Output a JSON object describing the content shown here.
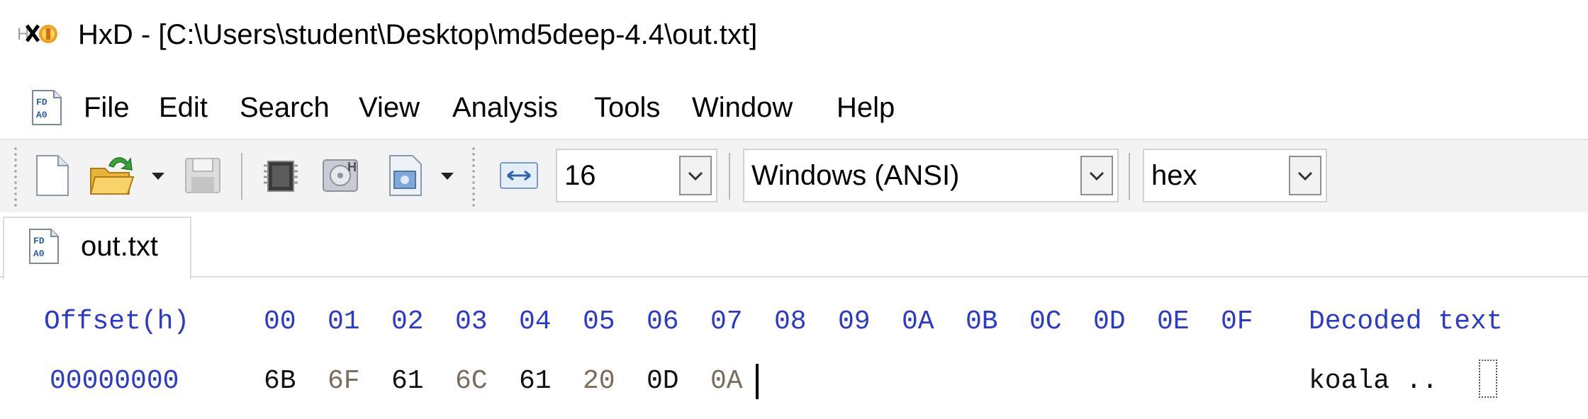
{
  "window": {
    "title": "HxD - [C:\\Users\\student\\Desktop\\md5deep-4.4\\out.txt]"
  },
  "menu": [
    "File",
    "Edit",
    "Search",
    "View",
    "Analysis",
    "Tools",
    "Window",
    "Help"
  ],
  "toolbar": {
    "bytes_per_row": "16",
    "charset": "Windows (ANSI)",
    "offset_base": "hex"
  },
  "tabs": [
    {
      "label": "out.txt",
      "active": true
    }
  ],
  "hex_view": {
    "offset_header": "Offset(h)",
    "column_headers": [
      "00",
      "01",
      "02",
      "03",
      "04",
      "05",
      "06",
      "07",
      "08",
      "09",
      "0A",
      "0B",
      "0C",
      "0D",
      "0E",
      "0F"
    ],
    "decoded_header": "Decoded text",
    "rows": [
      {
        "offset": "00000000",
        "bytes": [
          "6B",
          "6F",
          "61",
          "6C",
          "61",
          "20",
          "0D",
          "0A"
        ],
        "decoded": "koala .."
      }
    ]
  },
  "colors": {
    "header_blue": "#2a3acb",
    "byte_dark": "#111111",
    "byte_light": "#7a6c5c",
    "toolbar_bg": "#f3f3f3"
  },
  "icons": [
    "hxd-app-icon",
    "hxd-document-icon",
    "new-file-icon",
    "open-file-icon",
    "save-icon",
    "ram-icon",
    "disk-icon",
    "process-icon",
    "bytes-per-row-icon"
  ]
}
